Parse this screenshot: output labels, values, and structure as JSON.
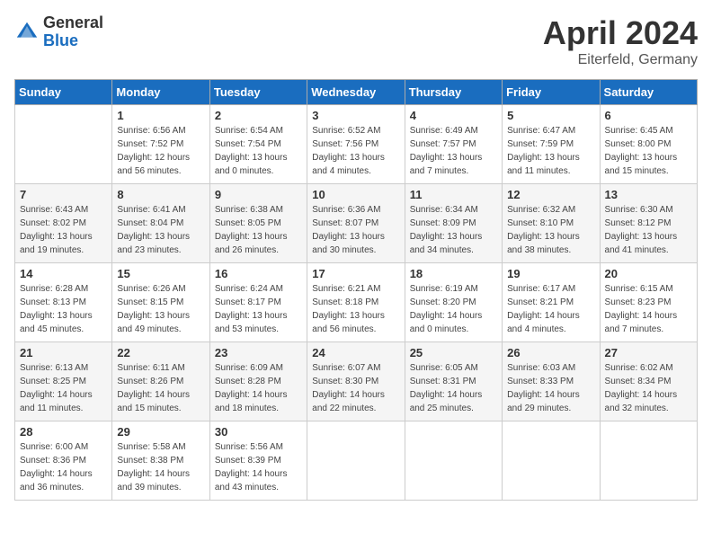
{
  "header": {
    "logo_general": "General",
    "logo_blue": "Blue",
    "month_year": "April 2024",
    "location": "Eiterfeld, Germany"
  },
  "days_of_week": [
    "Sunday",
    "Monday",
    "Tuesday",
    "Wednesday",
    "Thursday",
    "Friday",
    "Saturday"
  ],
  "weeks": [
    [
      {
        "day": "",
        "sunrise": "",
        "sunset": "",
        "daylight": ""
      },
      {
        "day": "1",
        "sunrise": "Sunrise: 6:56 AM",
        "sunset": "Sunset: 7:52 PM",
        "daylight": "Daylight: 12 hours and 56 minutes."
      },
      {
        "day": "2",
        "sunrise": "Sunrise: 6:54 AM",
        "sunset": "Sunset: 7:54 PM",
        "daylight": "Daylight: 13 hours and 0 minutes."
      },
      {
        "day": "3",
        "sunrise": "Sunrise: 6:52 AM",
        "sunset": "Sunset: 7:56 PM",
        "daylight": "Daylight: 13 hours and 4 minutes."
      },
      {
        "day": "4",
        "sunrise": "Sunrise: 6:49 AM",
        "sunset": "Sunset: 7:57 PM",
        "daylight": "Daylight: 13 hours and 7 minutes."
      },
      {
        "day": "5",
        "sunrise": "Sunrise: 6:47 AM",
        "sunset": "Sunset: 7:59 PM",
        "daylight": "Daylight: 13 hours and 11 minutes."
      },
      {
        "day": "6",
        "sunrise": "Sunrise: 6:45 AM",
        "sunset": "Sunset: 8:00 PM",
        "daylight": "Daylight: 13 hours and 15 minutes."
      }
    ],
    [
      {
        "day": "7",
        "sunrise": "Sunrise: 6:43 AM",
        "sunset": "Sunset: 8:02 PM",
        "daylight": "Daylight: 13 hours and 19 minutes."
      },
      {
        "day": "8",
        "sunrise": "Sunrise: 6:41 AM",
        "sunset": "Sunset: 8:04 PM",
        "daylight": "Daylight: 13 hours and 23 minutes."
      },
      {
        "day": "9",
        "sunrise": "Sunrise: 6:38 AM",
        "sunset": "Sunset: 8:05 PM",
        "daylight": "Daylight: 13 hours and 26 minutes."
      },
      {
        "day": "10",
        "sunrise": "Sunrise: 6:36 AM",
        "sunset": "Sunset: 8:07 PM",
        "daylight": "Daylight: 13 hours and 30 minutes."
      },
      {
        "day": "11",
        "sunrise": "Sunrise: 6:34 AM",
        "sunset": "Sunset: 8:09 PM",
        "daylight": "Daylight: 13 hours and 34 minutes."
      },
      {
        "day": "12",
        "sunrise": "Sunrise: 6:32 AM",
        "sunset": "Sunset: 8:10 PM",
        "daylight": "Daylight: 13 hours and 38 minutes."
      },
      {
        "day": "13",
        "sunrise": "Sunrise: 6:30 AM",
        "sunset": "Sunset: 8:12 PM",
        "daylight": "Daylight: 13 hours and 41 minutes."
      }
    ],
    [
      {
        "day": "14",
        "sunrise": "Sunrise: 6:28 AM",
        "sunset": "Sunset: 8:13 PM",
        "daylight": "Daylight: 13 hours and 45 minutes."
      },
      {
        "day": "15",
        "sunrise": "Sunrise: 6:26 AM",
        "sunset": "Sunset: 8:15 PM",
        "daylight": "Daylight: 13 hours and 49 minutes."
      },
      {
        "day": "16",
        "sunrise": "Sunrise: 6:24 AM",
        "sunset": "Sunset: 8:17 PM",
        "daylight": "Daylight: 13 hours and 53 minutes."
      },
      {
        "day": "17",
        "sunrise": "Sunrise: 6:21 AM",
        "sunset": "Sunset: 8:18 PM",
        "daylight": "Daylight: 13 hours and 56 minutes."
      },
      {
        "day": "18",
        "sunrise": "Sunrise: 6:19 AM",
        "sunset": "Sunset: 8:20 PM",
        "daylight": "Daylight: 14 hours and 0 minutes."
      },
      {
        "day": "19",
        "sunrise": "Sunrise: 6:17 AM",
        "sunset": "Sunset: 8:21 PM",
        "daylight": "Daylight: 14 hours and 4 minutes."
      },
      {
        "day": "20",
        "sunrise": "Sunrise: 6:15 AM",
        "sunset": "Sunset: 8:23 PM",
        "daylight": "Daylight: 14 hours and 7 minutes."
      }
    ],
    [
      {
        "day": "21",
        "sunrise": "Sunrise: 6:13 AM",
        "sunset": "Sunset: 8:25 PM",
        "daylight": "Daylight: 14 hours and 11 minutes."
      },
      {
        "day": "22",
        "sunrise": "Sunrise: 6:11 AM",
        "sunset": "Sunset: 8:26 PM",
        "daylight": "Daylight: 14 hours and 15 minutes."
      },
      {
        "day": "23",
        "sunrise": "Sunrise: 6:09 AM",
        "sunset": "Sunset: 8:28 PM",
        "daylight": "Daylight: 14 hours and 18 minutes."
      },
      {
        "day": "24",
        "sunrise": "Sunrise: 6:07 AM",
        "sunset": "Sunset: 8:30 PM",
        "daylight": "Daylight: 14 hours and 22 minutes."
      },
      {
        "day": "25",
        "sunrise": "Sunrise: 6:05 AM",
        "sunset": "Sunset: 8:31 PM",
        "daylight": "Daylight: 14 hours and 25 minutes."
      },
      {
        "day": "26",
        "sunrise": "Sunrise: 6:03 AM",
        "sunset": "Sunset: 8:33 PM",
        "daylight": "Daylight: 14 hours and 29 minutes."
      },
      {
        "day": "27",
        "sunrise": "Sunrise: 6:02 AM",
        "sunset": "Sunset: 8:34 PM",
        "daylight": "Daylight: 14 hours and 32 minutes."
      }
    ],
    [
      {
        "day": "28",
        "sunrise": "Sunrise: 6:00 AM",
        "sunset": "Sunset: 8:36 PM",
        "daylight": "Daylight: 14 hours and 36 minutes."
      },
      {
        "day": "29",
        "sunrise": "Sunrise: 5:58 AM",
        "sunset": "Sunset: 8:38 PM",
        "daylight": "Daylight: 14 hours and 39 minutes."
      },
      {
        "day": "30",
        "sunrise": "Sunrise: 5:56 AM",
        "sunset": "Sunset: 8:39 PM",
        "daylight": "Daylight: 14 hours and 43 minutes."
      },
      {
        "day": "",
        "sunrise": "",
        "sunset": "",
        "daylight": ""
      },
      {
        "day": "",
        "sunrise": "",
        "sunset": "",
        "daylight": ""
      },
      {
        "day": "",
        "sunrise": "",
        "sunset": "",
        "daylight": ""
      },
      {
        "day": "",
        "sunrise": "",
        "sunset": "",
        "daylight": ""
      }
    ]
  ]
}
